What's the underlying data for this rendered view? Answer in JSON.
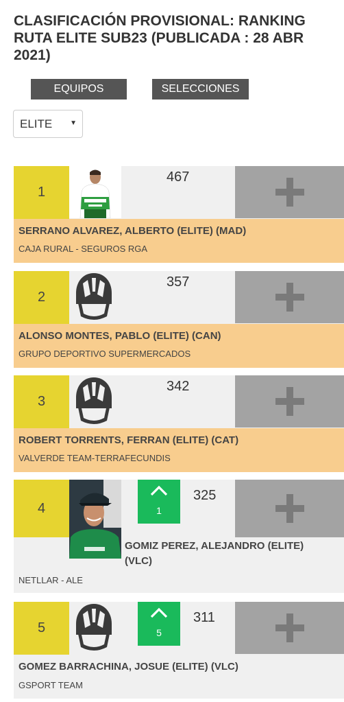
{
  "page": {
    "title": "CLASIFICACIÓN PROVISIONAL: RANKING RUTA ELITE SUB23 (PUBLICADA : 28 ABR 2021)"
  },
  "tabs": {
    "equipos": "EQUIPOS",
    "selecciones": "SELECCIONES"
  },
  "category_select": {
    "value": "ELITE"
  },
  "colors": {
    "position_bg": "#e6d430",
    "name_band_bg": "#f8cd8e",
    "card_bg": "#f0f0f0",
    "add_button_bg": "#a3a3a3",
    "movement_up": "#1aba5b"
  },
  "ranking": [
    {
      "position": "1",
      "points": "467",
      "name": "SERRANO ALVAREZ, ALBERTO (ELITE) (MAD)",
      "team": "CAJA RURAL - SEGUROS RGA",
      "movement": "",
      "avatar": "rider-photo"
    },
    {
      "position": "2",
      "points": "357",
      "name": "ALONSO MONTES, PABLO (ELITE) (CAN)",
      "team": "GRUPO DEPORTIVO SUPERMERCADOS",
      "movement": "",
      "avatar": "helmet-icon"
    },
    {
      "position": "3",
      "points": "342",
      "name": "ROBERT TORRENTS, FERRAN (ELITE) (CAT)",
      "team": "VALVERDE TEAM-TERRAFECUNDIS",
      "movement": "",
      "avatar": "helmet-icon"
    },
    {
      "position": "4",
      "points": "325",
      "name": "GOMIZ PEREZ, ALEJANDRO (ELITE) (VLC)",
      "team": "NETLLAR - ALE",
      "movement": "1",
      "avatar": "rider-photo"
    },
    {
      "position": "5",
      "points": "311",
      "name": "GOMEZ BARRACHINA, JOSUE (ELITE) (VLC)",
      "team": "GSPORT TEAM",
      "movement": "5",
      "avatar": "helmet-icon"
    }
  ]
}
